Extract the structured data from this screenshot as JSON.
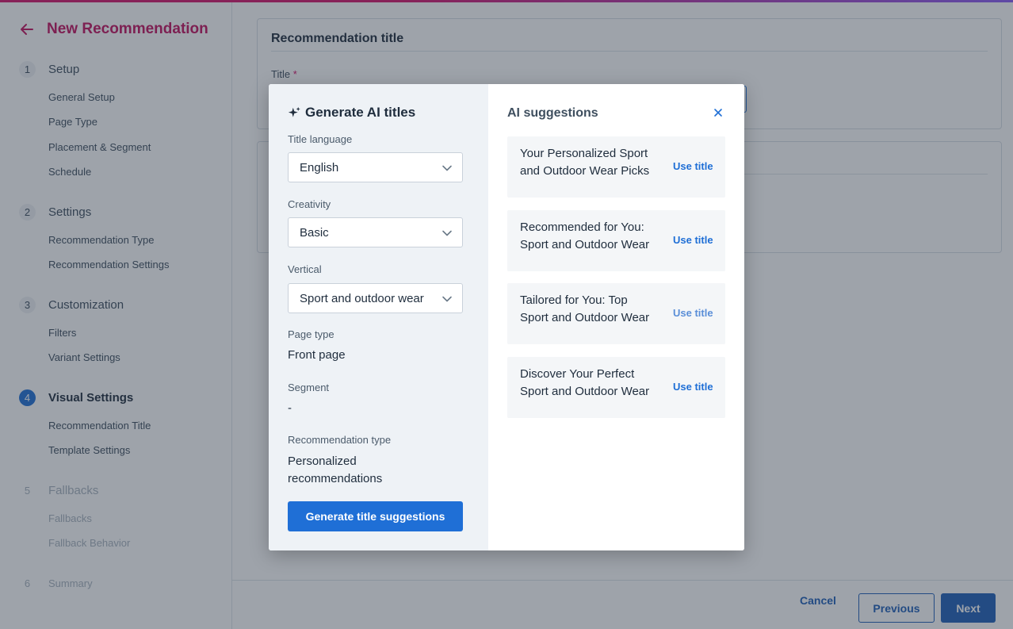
{
  "sidebar": {
    "title": "New Recommendation",
    "steps": [
      {
        "num": "1",
        "label": "Setup",
        "subs": [
          "General Setup",
          "Page Type",
          "Placement & Segment",
          "Schedule"
        ]
      },
      {
        "num": "2",
        "label": "Settings",
        "subs": [
          "Recommendation Type",
          "Recommendation Settings"
        ]
      },
      {
        "num": "3",
        "label": "Customization",
        "subs": [
          "Filters",
          "Variant Settings"
        ]
      },
      {
        "num": "4",
        "label": "Visual Settings",
        "subs": [
          "Recommendation Title",
          "Template Settings"
        ]
      },
      {
        "num": "5",
        "label": "Fallbacks",
        "subs": [
          "Fallbacks",
          "Fallback Behavior"
        ]
      },
      {
        "num": "6",
        "label": "Summary",
        "subs": []
      }
    ]
  },
  "main": {
    "card_title": "Recommendation title",
    "field_label": "Title",
    "required_mark": "*"
  },
  "footer": {
    "cancel": "Cancel",
    "previous": "Previous",
    "next": "Next"
  },
  "modal": {
    "title": "Generate AI titles",
    "fields": {
      "language_label": "Title language",
      "language_value": "English",
      "creativity_label": "Creativity",
      "creativity_value": "Basic",
      "vertical_label": "Vertical",
      "vertical_value": "Sport and outdoor wear",
      "page_type_label": "Page type",
      "page_type_value": "Front page",
      "segment_label": "Segment",
      "segment_value": "-",
      "rec_type_label": "Recommendation type",
      "rec_type_value_line1": "Personalized",
      "rec_type_value_line2": "recommendations"
    },
    "generate_button": "Generate title suggestions",
    "suggestions_title": "AI suggestions",
    "use_label": "Use title",
    "suggestions": [
      {
        "line1": "Your Personalized Sport",
        "line2": "and Outdoor Wear Picks"
      },
      {
        "line1": "Recommended for You:",
        "line2": "Sport and Outdoor Wear"
      },
      {
        "line1": "Tailored for You: Top",
        "line2": "Sport and Outdoor Wear"
      },
      {
        "line1": "Discover Your Perfect",
        "line2": "Sport and Outdoor Wear"
      }
    ]
  },
  "colors": {
    "brand": "#d5156c",
    "primary": "#1f6fd6",
    "active_step": "#1f6fd6"
  },
  "icons": [
    "back-arrow-icon",
    "sparkle-icon",
    "chevron-down-icon",
    "close-icon"
  ]
}
